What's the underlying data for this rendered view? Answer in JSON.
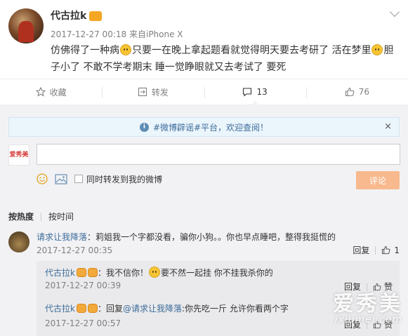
{
  "post": {
    "username": "代古拉k",
    "vip_badge": "",
    "timestamp": "2017-12-27 00:18",
    "source_prefix": "来自",
    "device": "iPhone X",
    "text_1": "仿佛得了一种病",
    "text_2": "只要一在晚上拿起题看就觉得明天要去考研了 活在梦里",
    "text_3": "胆子小了 不敢不学考期末 睡一觉睁眼就又去考试了 要死"
  },
  "actions": {
    "favorite_label": "收藏",
    "repost_label": "转发",
    "comment_count": "13",
    "like_count": "76"
  },
  "comment_box": {
    "notice_text": "#微博辟谣#平台，欢迎查阅！",
    "close_glyph": "×",
    "my_avatar_text": "爱秀美",
    "input_value": "",
    "input_placeholder": "",
    "also_repost_label": "同时转发到我的微博",
    "submit_label": "评论"
  },
  "sort": {
    "by_hot": "按热度",
    "by_time": "按时间"
  },
  "comments": [
    {
      "author": "请求让我降落",
      "text": "：莉姐我一个字都没看，骗你小狗。。你也早点睡吧，整得我挺慌的",
      "time": "2017-12-27 00:35",
      "reply_label": "回复",
      "like_count": "1"
    }
  ],
  "replies": [
    {
      "author": "代古拉k",
      "text_1": "：我不信你！",
      "text_2": "要不然一起挂 你不挂我杀你的",
      "time": "2017-12-27 00:39",
      "reply_label": "回复",
      "like_label": "赞"
    },
    {
      "author": "代古拉k",
      "text_prefix": "：回复",
      "mention": "@请求让我降落",
      "text_suffix": ":你先吃一斤 允许你看两个字",
      "time": "2017-12-27 00:57",
      "reply_label": "回复",
      "like_label": "赞"
    }
  ],
  "watermark": {
    "brand": "爱秀美",
    "domain": "ixiumei.com"
  },
  "colors": {
    "link": "#3d6c99",
    "submit_disabled": "#f8b98e",
    "comment_bg": "#f2f2f5",
    "notice_bg": "#eaf5fc"
  }
}
